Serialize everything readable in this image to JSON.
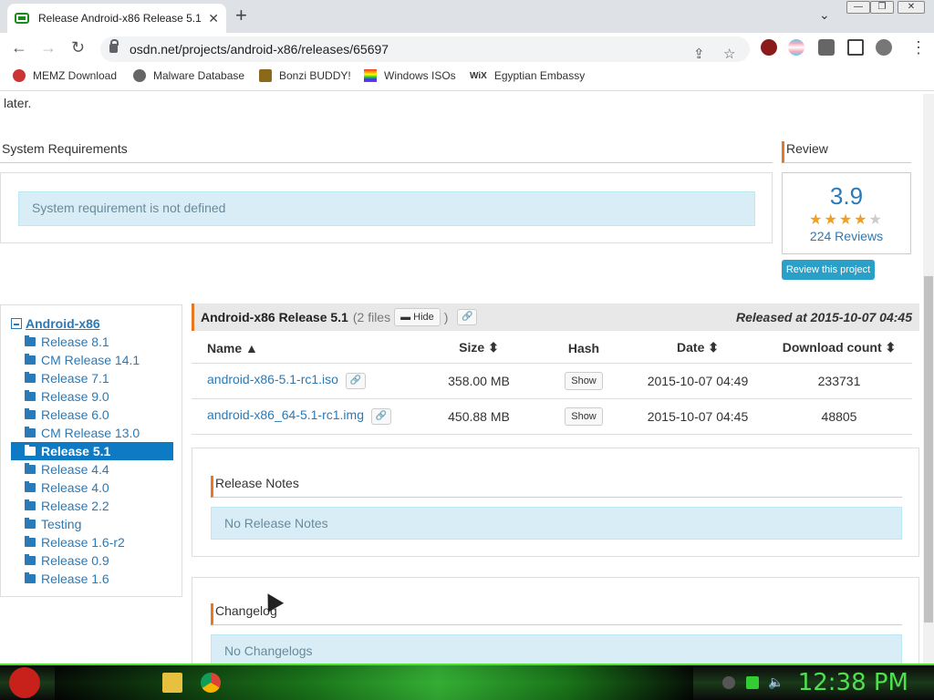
{
  "browser": {
    "tab_title": "Release Android-x86 Release 5.1",
    "new_tab": "+",
    "url": "osdn.net/projects/android-x86/releases/65697",
    "bookmarks": [
      "MEMZ Download",
      "Malware Database",
      "Bonzi BUDDY!",
      "Windows ISOs",
      "Egyptian Embassy"
    ]
  },
  "page": {
    "top_text": "later.",
    "system_requirements": {
      "heading": "System Requirements",
      "message": "System requirement is not defined"
    },
    "review": {
      "heading": "Review",
      "rating": "3.9",
      "stars_filled": 4,
      "stars_total": 5,
      "reviews_link": "224 Reviews",
      "button": "Review this project"
    },
    "tree": {
      "root": "Android-x86",
      "items": [
        "Release 8.1",
        "CM Release 14.1",
        "Release 7.1",
        "Release 9.0",
        "Release 6.0",
        "CM Release 13.0",
        "Release 5.1",
        "Release 4.4",
        "Release 4.0",
        "Release 2.2",
        "Testing",
        "Release 1.6-r2",
        "Release 0.9",
        "Release 1.6"
      ],
      "active_index": 6
    },
    "release": {
      "title": "Android-x86 Release 5.1",
      "count": "(2 files",
      "hide_label": "Hide",
      "count_close": ")",
      "released_at": "Released at 2015-10-07 04:45"
    },
    "table": {
      "headers": {
        "name": "Name ▲",
        "size": "Size ⬍",
        "hash": "Hash",
        "date": "Date ⬍",
        "downloads": "Download count ⬍"
      },
      "rows": [
        {
          "name": "android-x86-5.1-rc1.iso",
          "size": "358.00 MB",
          "hash": "Show",
          "date": "2015-10-07 04:49",
          "downloads": "233731"
        },
        {
          "name": "android-x86_64-5.1-rc1.img",
          "size": "450.88 MB",
          "hash": "Show",
          "date": "2015-10-07 04:45",
          "downloads": "48805"
        }
      ]
    },
    "release_notes": {
      "heading": "Release Notes",
      "message": "No Release Notes"
    },
    "changelog": {
      "heading": "Changelog",
      "message": "No Changelogs"
    }
  },
  "taskbar": {
    "clock": "12:38 PM"
  },
  "colors": {
    "accent": "#e87722",
    "link": "#2a7ab8",
    "active": "#0e7ac4"
  }
}
